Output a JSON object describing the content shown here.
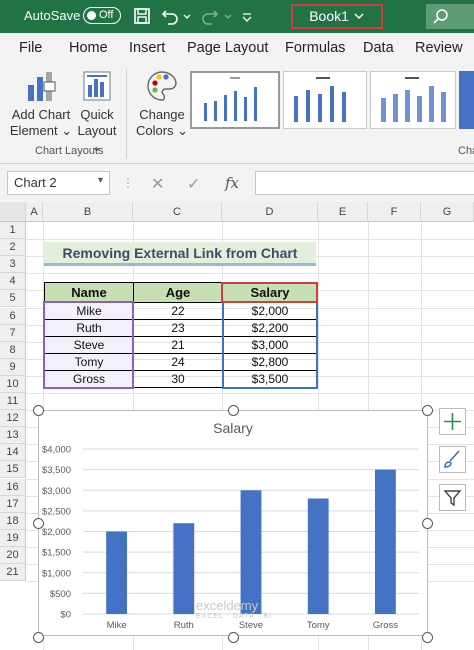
{
  "titlebar": {
    "autosave": "AutoSave",
    "toggle": "Off",
    "workbook": "Book1"
  },
  "tabs": [
    "File",
    "Home",
    "Insert",
    "Page Layout",
    "Formulas",
    "Data",
    "Review"
  ],
  "ribbon": {
    "add_chart_element": [
      "Add Chart",
      "Element"
    ],
    "quick_layout": [
      "Quick",
      "Layout"
    ],
    "change_colors": [
      "Change",
      "Colors"
    ],
    "group_chart_layouts": "Chart Layouts",
    "group_chart_styles_partial": "Char"
  },
  "formula_bar": {
    "name_box": "Chart 2",
    "fx": "fx"
  },
  "columns": [
    "A",
    "B",
    "C",
    "D",
    "E",
    "F",
    "G"
  ],
  "rows": [
    "1",
    "2",
    "3",
    "4",
    "5",
    "6",
    "7",
    "8",
    "9",
    "10",
    "11",
    "12",
    "13",
    "14",
    "15",
    "16",
    "17",
    "18",
    "19",
    "20",
    "21"
  ],
  "sheet": {
    "title": "Removing External Link from Chart",
    "headers": [
      "Name",
      "Age",
      "Salary"
    ],
    "records": [
      [
        "Mike",
        "22",
        "$2,000"
      ],
      [
        "Ruth",
        "23",
        "$2,200"
      ],
      [
        "Steve",
        "21",
        "$3,000"
      ],
      [
        "Tomy",
        "24",
        "$2,800"
      ],
      [
        "Gross",
        "30",
        "$3,500"
      ]
    ]
  },
  "chart_data": {
    "type": "bar",
    "title": "Salary",
    "categories": [
      "Mike",
      "Ruth",
      "Steve",
      "Tomy",
      "Gross"
    ],
    "values": [
      2000,
      2200,
      3000,
      2800,
      3500
    ],
    "ylim": [
      0,
      4000
    ],
    "yticks": [
      "$0",
      "$500",
      "$1,000",
      "$1,500",
      "$2,000",
      "$2,500",
      "$3,000",
      "$3,500",
      "$4,000"
    ],
    "color": "#4472c4",
    "grid": true
  },
  "watermark": {
    "name": "exceldemy",
    "tagline": "EXCEL · DATA · BI"
  },
  "colors": {
    "excel_green": "#217346",
    "title_fill": "#e2efda",
    "header_fill": "#c6e0b4"
  }
}
